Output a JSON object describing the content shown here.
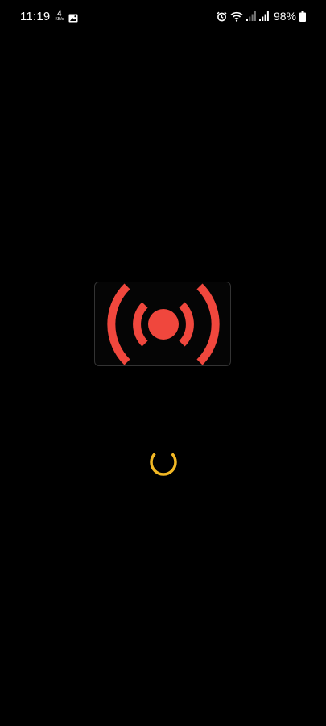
{
  "status_bar": {
    "time": "11:19",
    "net_speed_value": "4",
    "net_speed_unit": "KB/s",
    "battery_percent": "98%",
    "icons": [
      "gallery-icon",
      "alarm-icon",
      "wifi-icon",
      "signal-icon",
      "signal-icon",
      "battery-icon"
    ]
  },
  "splash": {
    "logo_icon": "broadcast-icon",
    "loading_icon": "loading-spinner"
  },
  "colors": {
    "background": "#000000",
    "logo_red": "#F0473D",
    "spinner_yellow": "#F2B824",
    "status_text": "#FFFFFF"
  }
}
